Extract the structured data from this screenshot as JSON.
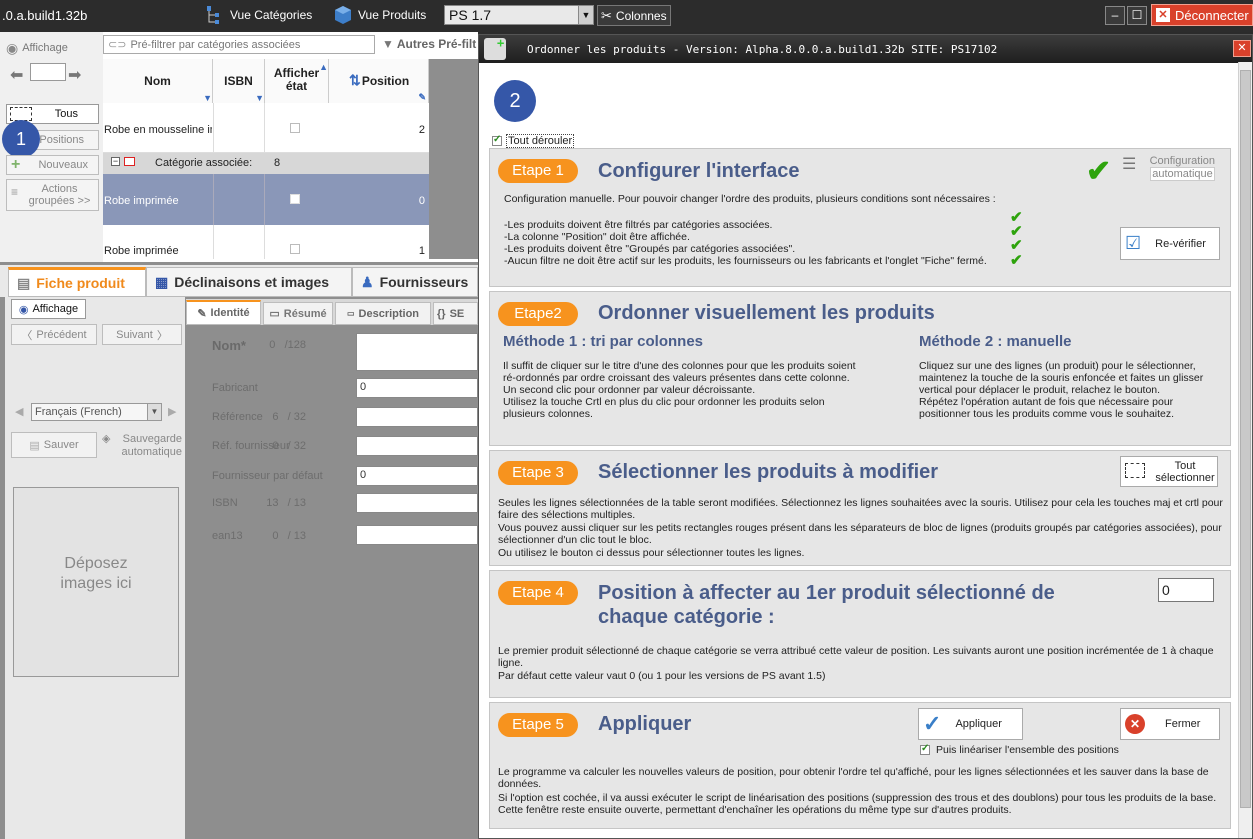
{
  "app": {
    "title": ".0.a.build1.32b",
    "vue_categories": "Vue Catégories",
    "vue_produits": "Vue Produits",
    "ps_select": "PS 1.7",
    "colonnes": "Colonnes",
    "deconnecter": "Déconnecter"
  },
  "left_panel": {
    "affichage": "Affichage",
    "prefilter_placeholder": "Pré-filtrer par catégories associées",
    "autres": "Autres Pré-filt",
    "tous": "Tous",
    "positions": "Positions",
    "nouveaux": "Nouveaux",
    "actions_line1": "Actions",
    "actions_line2": "groupées >>",
    "badge1": "1",
    "columns": [
      "Nom",
      "ISBN",
      "Afficher état",
      "Position"
    ],
    "rows": [
      {
        "nom": "Robe en mousseline im",
        "position": "2"
      },
      {
        "group_label": "Catégorie associée:",
        "group_count": "8"
      },
      {
        "nom": "Robe imprimée",
        "position": "0"
      },
      {
        "nom": "Robe imprimée",
        "position": "1"
      }
    ]
  },
  "product_tabs": {
    "fiche": "Fiche produit",
    "declinaisons": "Déclinaisons et images",
    "fournisseurs": "Fournisseurs",
    "affichage": "Affichage",
    "precedent": "Précédent",
    "suivant": "Suivant",
    "langue": "Français (French)",
    "sauver": "Sauver",
    "sauvegarde": "Sauvegarde",
    "automatique": "automatique",
    "deposez_line1": "Déposez",
    "deposez_line2": "images ici",
    "subtabs": [
      "Identité",
      "Résumé",
      "Description",
      "SE"
    ]
  },
  "form_fields": [
    {
      "label": "Nom*",
      "count": "0",
      "max": "/128",
      "value": ""
    },
    {
      "label": "Fabricant",
      "count": "",
      "max": "",
      "value": "0"
    },
    {
      "label": "Référence",
      "count": "6",
      "max": "/ 32",
      "value": ""
    },
    {
      "label": "Réf. fournisseur",
      "count": "0",
      "max": "/ 32",
      "value": ""
    },
    {
      "label": "Fournisseur par défaut",
      "count": "",
      "max": "",
      "value": "0"
    },
    {
      "label": "ISBN",
      "count": "13",
      "max": "/ 13",
      "value": ""
    },
    {
      "label": "ean13",
      "count": "0",
      "max": "/ 13",
      "value": ""
    }
  ],
  "dialog": {
    "title": "Ordonner les produits - Version: Alpha.8.0.0.a.build1.32b   SITE: PS17102",
    "badge2": "2",
    "tout_derouler": "Tout dérouler",
    "step1": {
      "tag": "Etape 1",
      "heading": "Configurer l'interface",
      "config_auto_line1": "Configuration",
      "config_auto_line2": "automatique",
      "intro": "Configuration manuelle. Pour pouvoir changer l'ordre des produits, plusieurs conditions sont nécessaires :",
      "conditions": [
        "-Les produits doivent être filtrés par catégories associées.",
        "-La colonne \"Position\" doit être affichée.",
        "-Les produits doivent être \"Groupés par catégories associées\".",
        "-Aucun filtre ne doit être actif sur les produits, les fournisseurs ou les fabricants et l'onglet \"Fiche\" fermé."
      ],
      "reverifier": "Re-vérifier"
    },
    "step2": {
      "tag": "Etape2",
      "heading": "Ordonner visuellement les produits",
      "m1_title": "Méthode 1 : tri par colonnes",
      "m1_lines": [
        "Il suffit de cliquer sur le titre d'une des colonnes pour que les produits soient",
        "ré-ordonnés par ordre croissant des valeurs présentes dans cette colonne.",
        "Un second clic pour ordonner par valeur décroissante.",
        "Utilisez la touche Crtl en plus du clic pour ordonner les produits selon",
        "plusieurs colonnes."
      ],
      "m2_title": "Méthode 2 : manuelle",
      "m2_lines": [
        "Cliquez sur une des lignes (un produit) pour le sélectionner,",
        "maintenez la touche de la souris  enfoncée et faites un glisser",
        "vertical pour déplacer le produit, relachez le bouton.",
        "Répétez l'opération autant de fois que nécessaire pour",
        "positionner tous les produits comme vous le souhaitez."
      ]
    },
    "step3": {
      "tag": "Etape 3",
      "heading": "Sélectionner les produits à modifier",
      "tout_line1": "Tout",
      "tout_line2": "sélectionner",
      "lines": [
        "Seules les lignes sélectionnées de la table seront modifiées. Sélectionnez les lignes souhaitées avec la souris. Utilisez pour cela les touches maj et crtl pour",
        "faire des sélections multiples.",
        "Vous pouvez aussi cliquer sur les petits rectangles rouges présent dans les séparateurs de bloc de lignes (produits groupés par catégories associées), pour",
        "sélectionner d'un clic tout le bloc.",
        "Ou utilisez le bouton ci dessus pour sélectionner toutes les lignes."
      ]
    },
    "step4": {
      "tag": "Etape 4",
      "heading_line1": "Position à affecter au 1er produit sélectionné de",
      "heading_line2": "chaque catégorie :",
      "value": "0",
      "lines": [
        "Le premier produit sélectionné de chaque catégorie se verra attribué cette valeur de position. Les suivants auront une position incrémentée de 1 à chaque",
        "ligne.",
        "Par défaut cette valeur vaut 0 (ou 1 pour les versions de PS avant 1.5)"
      ]
    },
    "step5": {
      "tag": "Etape 5",
      "heading": "Appliquer",
      "appliquer": "Appliquer",
      "fermer": "Fermer",
      "lineariser": "Puis linéariser l'ensemble des positions",
      "lines": [
        "Le programme va calculer les nouvelles valeurs de position, pour obtenir l'ordre tel qu'affiché, pour les lignes sélectionnées et les sauver dans la base de",
        "données.",
        "Si l'option est cochée, il va aussi exécuter le script de linéarisation des positions (suppression des trous et des doublons) pour tous les produits de la base.",
        "Cette fenêtre reste ensuite ouverte, permettant d'enchaîner les opérations du même type sur d'autres produits."
      ]
    }
  }
}
